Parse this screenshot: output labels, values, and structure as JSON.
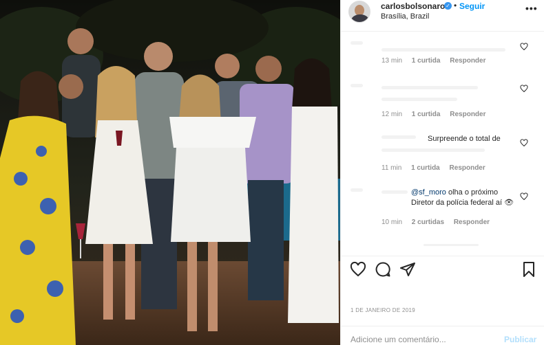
{
  "post": {
    "username": "carlosbolsonaro",
    "verified_mark": "✓",
    "separator": "•",
    "follow_label": "Seguir",
    "location": "Brasília, Brazil",
    "more_label": "•••",
    "photo_description_icon": "group-photo"
  },
  "comments": [
    {
      "text": "",
      "time": "13 min",
      "likes": "1 curtida",
      "reply": "Responder"
    },
    {
      "text": "",
      "time": "12 min",
      "likes": "1 curtida",
      "reply": "Responder"
    },
    {
      "text": "Surpreende o total de",
      "time": "11 min",
      "likes": "1 curtida",
      "reply": "Responder"
    },
    {
      "mention": "@sf_moro",
      "text": " olha o próximo Diretor da polícia federal aí 👁",
      "time": "10 min",
      "likes": "2 curtidas",
      "reply": "Responder"
    }
  ],
  "actions": {
    "like_icon": "heart-icon",
    "comment_icon": "comment-icon",
    "share_icon": "share-icon",
    "save_icon": "bookmark-icon"
  },
  "date": "1 DE JANEIRO DE 2019",
  "add_comment": {
    "placeholder": "Adicione um comentário...",
    "publish_label": "Publicar"
  },
  "colors": {
    "accent": "#0095f6",
    "publish_disabled": "#b2dffc",
    "meta_gray": "#8e8e8e"
  }
}
